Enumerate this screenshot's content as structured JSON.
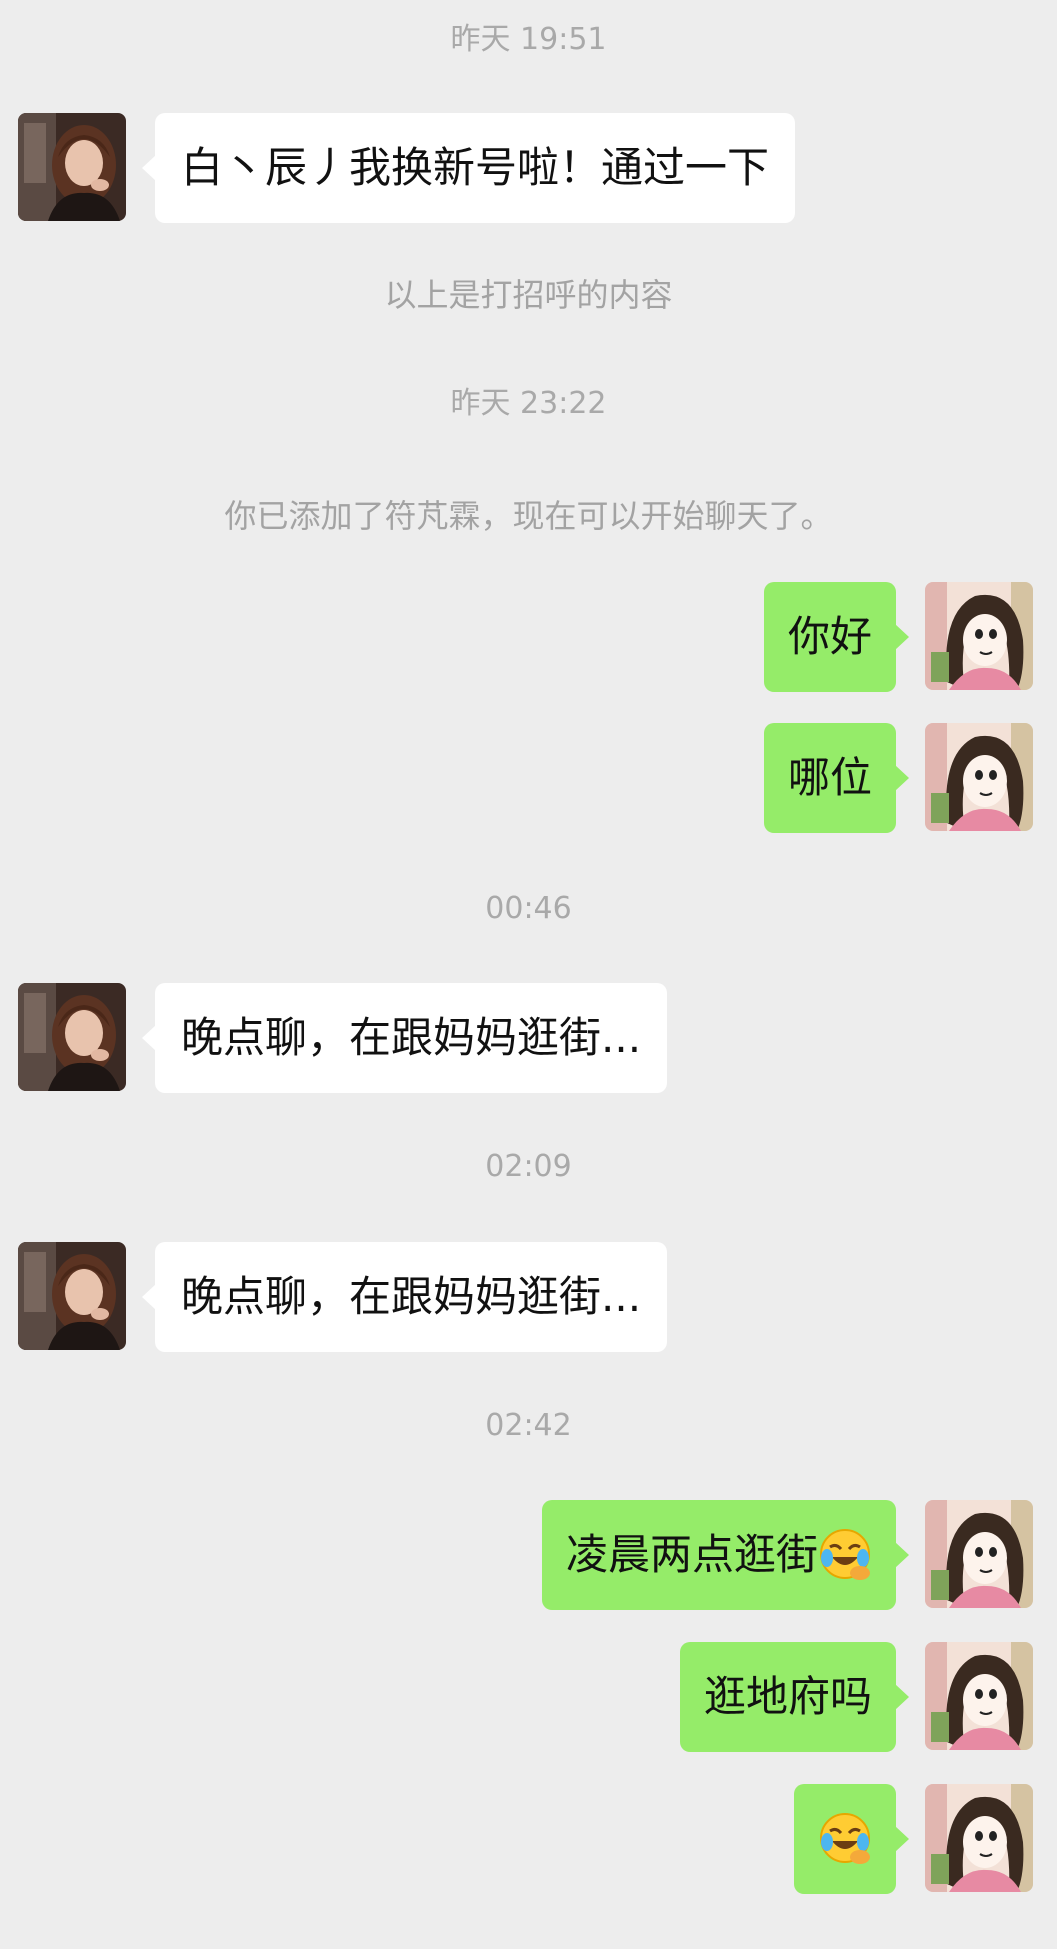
{
  "chat": {
    "timestamps": [
      "昨天 19:51",
      "昨天 23:22",
      "00:46",
      "02:09",
      "02:42"
    ],
    "system_notes": [
      "以上是打招呼的内容",
      "你已添加了符芃霖，现在可以开始聊天了。"
    ],
    "messages": [
      {
        "sender": "contact",
        "text": "白丶辰丿我换新号啦！通过一下"
      },
      {
        "sender": "me",
        "text": "你好"
      },
      {
        "sender": "me",
        "text": "哪位"
      },
      {
        "sender": "contact",
        "text": "晚点聊，在跟妈妈逛街..."
      },
      {
        "sender": "contact",
        "text": "晚点聊，在跟妈妈逛街..."
      },
      {
        "sender": "me",
        "text": "凌晨两点逛街",
        "emoji": "laughing-crying-emoji"
      },
      {
        "sender": "me",
        "text": "逛地府吗"
      },
      {
        "sender": "me",
        "text": "",
        "emoji": "laughing-crying-emoji"
      }
    ]
  },
  "colors": {
    "background": "#ededed",
    "incoming_bubble": "#ffffff",
    "outgoing_bubble": "#95ec69",
    "timestamp_text": "#a9a9a9"
  },
  "icons": {
    "contact_avatar": "contact-avatar-photo",
    "user_avatar": "cartoon-girl-avatar"
  }
}
